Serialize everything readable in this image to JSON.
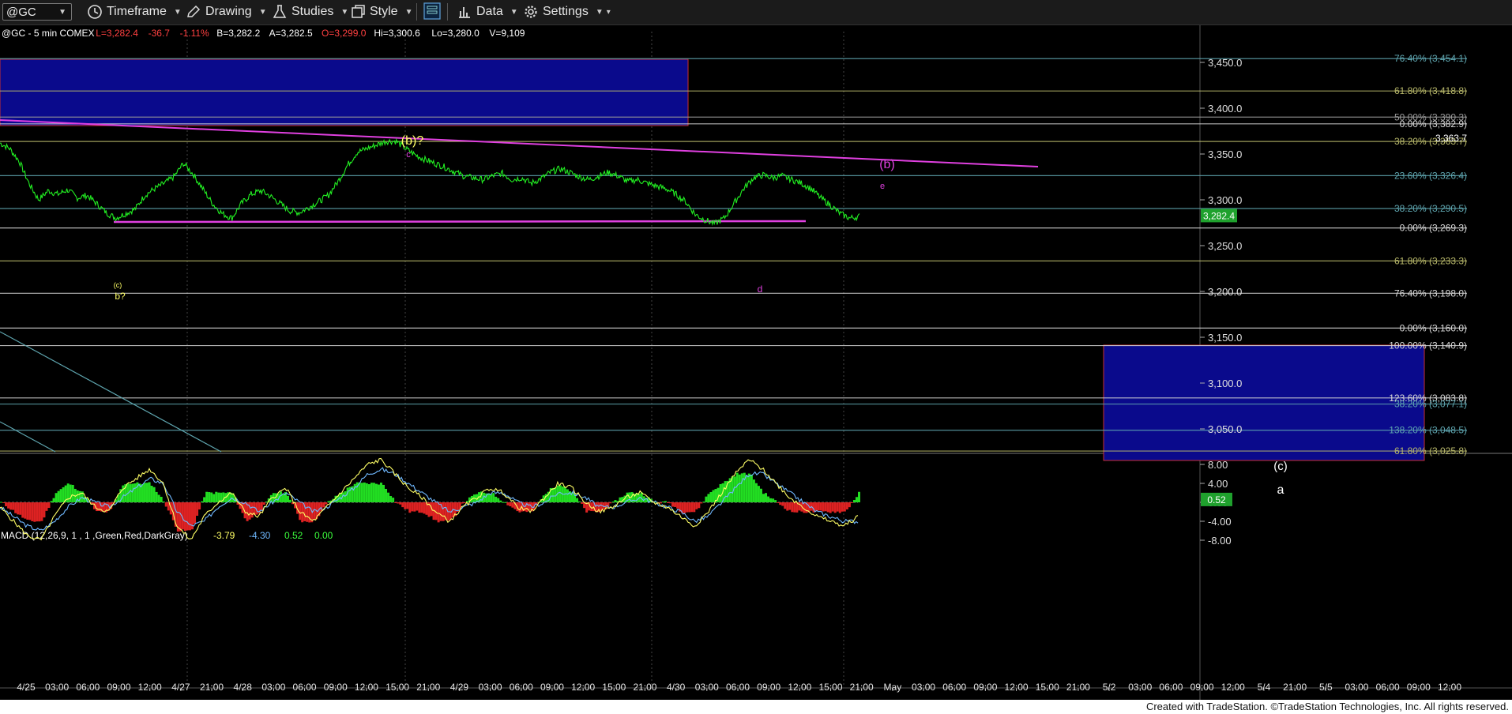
{
  "toolbar": {
    "symbol": "@GC",
    "timeframe_label": "Timeframe",
    "drawing_label": "Drawing",
    "studies_label": "Studies",
    "style_label": "Style",
    "data_label": "Data",
    "settings_label": "Settings",
    "icons": [
      "clock-icon",
      "pencil-icon",
      "flask-icon",
      "style-icon",
      "layout-icon",
      "bar-chart-icon",
      "gear-icon"
    ]
  },
  "header": {
    "symbol_info": "@GC - 5 min COMEX",
    "last": "L=3,282.4",
    "change": "-36.7",
    "change_pct": "-1.11%",
    "bid": "B=3,282.2",
    "ask": "A=3,282.5",
    "open": "O=3,299.0",
    "high": "Hi=3,300.6",
    "low": "Lo=3,280.0",
    "volume": "V=9,109"
  },
  "colors": {
    "price_line": "#22ee22",
    "magenta": "#e040e0",
    "yellow": "#ffff66",
    "fib_teal": "#5fa6b0",
    "fib_olive": "#b8b86a",
    "box_blue": "#0a0a8c",
    "box_border": "#c83030",
    "last_price_bg": "#1fa12d"
  },
  "footer": {
    "credit": "Created with TradeStation. ©TradeStation Technologies, Inc. All rights reserved."
  },
  "chart_data": [
    {
      "type": "line",
      "title": "@GC - 5 min COMEX",
      "ylim": [
        3010,
        3490
      ],
      "y_ticks": [
        "3,450.0",
        "3,400.0",
        "3,350.0",
        "3,300.0",
        "3,250.0",
        "3,200.0",
        "3,150.0",
        "3,100.0",
        "3,050.0"
      ],
      "y_tick_values": [
        3450,
        3400,
        3350,
        3300,
        3250,
        3200,
        3150,
        3100,
        3050
      ],
      "last_price_label": "3,282.4",
      "last_price": 3282.4,
      "x_ticks": [
        "4/25",
        "03:00",
        "06:00",
        "09:00",
        "12:00",
        "4/27",
        "21:00",
        "4/28",
        "03:00",
        "06:00",
        "09:00",
        "12:00",
        "15:00",
        "21:00",
        "4/29",
        "03:00",
        "06:00",
        "09:00",
        "12:00",
        "15:00",
        "21:00",
        "4/30",
        "03:00",
        "06:00",
        "09:00",
        "12:00",
        "15:00",
        "21:00",
        "May",
        "03:00",
        "06:00",
        "09:00",
        "12:00",
        "15:00",
        "21:00",
        "5/2",
        "03:00",
        "06:00",
        "09:00",
        "12:00",
        "5/4",
        "21:00",
        "5/5",
        "03:00",
        "06:00",
        "09:00",
        "12:00"
      ],
      "series": [
        {
          "values_x_index": [
            0,
            6,
            12,
            18,
            24,
            30,
            36,
            42,
            48,
            54,
            60,
            66,
            72,
            78,
            84,
            90,
            96,
            102,
            108,
            114,
            120,
            126,
            132,
            138,
            144,
            150,
            156,
            162,
            168,
            174,
            180,
            186,
            192,
            198,
            204,
            210,
            216,
            222,
            228,
            234,
            240,
            246,
            252,
            258,
            264,
            270,
            276,
            282,
            288,
            294,
            300,
            306,
            312,
            318,
            324,
            330,
            336,
            342,
            348,
            354,
            360,
            366,
            372,
            378,
            384,
            390,
            396,
            402,
            408,
            414,
            420,
            426,
            432,
            438,
            444,
            450
          ],
          "values": [
            3362,
            3356,
            3342,
            3318,
            3300,
            3310,
            3306,
            3311,
            3302,
            3305,
            3296,
            3286,
            3280,
            3285,
            3290,
            3305,
            3312,
            3318,
            3325,
            3340,
            3328,
            3312,
            3296,
            3285,
            3280,
            3296,
            3306,
            3310,
            3304,
            3296,
            3288,
            3286,
            3292,
            3298,
            3305,
            3320,
            3338,
            3352,
            3356,
            3360,
            3364,
            3364,
            3356,
            3349,
            3344,
            3340,
            3336,
            3331,
            3326,
            3324,
            3322,
            3326,
            3329,
            3322,
            3324,
            3318,
            3323,
            3330,
            3334,
            3330,
            3325,
            3322,
            3326,
            3330,
            3326,
            3320,
            3322,
            3318,
            3315,
            3312,
            3306,
            3298,
            3284,
            3278,
            3274,
            3280
          ],
          "note_tail": [
            3296,
            3312,
            3324,
            3327,
            3324,
            3326,
            3322,
            3318,
            3312,
            3302,
            3294,
            3285,
            3280,
            3282
          ]
        }
      ],
      "fib_levels": [
        {
          "label": "76.40% (3,454.1)",
          "value": 3454.1,
          "color": "teal"
        },
        {
          "label": "61.80% (3,418.8)",
          "value": 3418.8,
          "color": "olive"
        },
        {
          "label": "50.00% (3,390.3)",
          "value": 3390.3,
          "color": "gray"
        },
        {
          "label": "0.00% (3,382.9)",
          "value": 3382.9,
          "color": "white"
        },
        {
          "label": "38.20% (3,363.7)",
          "value": 3363.7,
          "color": "olive"
        },
        {
          "label": "23.60% (3,326.4)",
          "value": 3326.4,
          "color": "teal"
        },
        {
          "label": "38.20% (3,290.5)",
          "value": 3290.5,
          "color": "teal"
        },
        {
          "label": "0.00% (3,269.3)",
          "value": 3269.3,
          "color": "white"
        },
        {
          "label": "61.80% (3,233.3)",
          "value": 3233.3,
          "color": "olive"
        },
        {
          "label": "76.40% (3,198.0)",
          "value": 3198.0,
          "color": "white"
        },
        {
          "label": "0.00% (3,160.0)",
          "value": 3160.0,
          "color": "white"
        },
        {
          "label": "100.00% (3,140.9)",
          "value": 3140.9,
          "color": "white"
        },
        {
          "label": "123.60% (3,083.8)",
          "value": 3083.8,
          "color": "white"
        },
        {
          "label": "38.20% (3,077.1)",
          "value": 3077.1,
          "color": "teal"
        },
        {
          "label": "138.20% (3,048.5)",
          "value": 3048.5,
          "color": "teal"
        },
        {
          "label": "61.80% (3,025.8)",
          "value": 3025.8,
          "color": "olive"
        }
      ],
      "price_marker": {
        "label": "3,363.7",
        "value": 3363.7
      },
      "annotations": [
        {
          "text": "(b)?",
          "color": "yellow"
        },
        {
          "text": "c",
          "color": "magenta"
        },
        {
          "text": "(b)",
          "color": "magenta"
        },
        {
          "text": "e",
          "color": "magenta"
        },
        {
          "text": "d",
          "color": "magenta"
        },
        {
          "text": "(c)",
          "color": "yellow"
        },
        {
          "text": "b?",
          "color": "yellow"
        },
        {
          "text": "(c)",
          "color": "white"
        },
        {
          "text": "a",
          "color": "white"
        }
      ],
      "zones": [
        {
          "name": "upper-target-zone",
          "y_range": [
            3382,
            3455
          ]
        },
        {
          "name": "lower-target-zone",
          "y_range": [
            3035,
            3140
          ]
        }
      ],
      "grid": false
    },
    {
      "type": "line",
      "title": "MACD (12,26,9, 1 , 1 ,Green,Red,DarkGray)",
      "readouts": [
        "-3.79",
        "-4.30",
        "0.52",
        "0.00"
      ],
      "ylim": [
        -10,
        10
      ],
      "y_ticks": [
        "8.00",
        "4.00",
        "0.00",
        "-4.00",
        "-8.00"
      ],
      "y_tick_values": [
        8,
        4,
        0,
        -4,
        -8
      ],
      "last_value_label": "0.52",
      "last_value": 0.52,
      "series": [
        {
          "name": "MACD",
          "values": [
            -1,
            -4,
            -7,
            -8,
            -3,
            1,
            2,
            -1,
            -2,
            3,
            5,
            7,
            4,
            -5,
            -8,
            -3,
            0,
            2,
            -2,
            -3,
            1,
            3,
            -2,
            -4,
            -1,
            2,
            5,
            8,
            9,
            6,
            3,
            1,
            -2,
            -4,
            -1,
            1,
            3,
            2,
            -1,
            -2,
            1,
            4,
            3,
            0,
            -2,
            -1,
            1,
            2,
            0,
            -1,
            -3,
            -5,
            -2,
            2,
            6,
            9,
            7,
            4,
            1,
            -1,
            -3,
            -4,
            -5,
            -3
          ]
        },
        {
          "name": "Signal",
          "values": [
            -1,
            -3,
            -5,
            -6,
            -4,
            -1,
            1,
            0,
            -1,
            1,
            3,
            5,
            4,
            -2,
            -5,
            -4,
            -1,
            1,
            0,
            -2,
            0,
            2,
            0,
            -2,
            -1,
            1,
            3,
            6,
            7,
            6,
            4,
            2,
            0,
            -2,
            -1,
            0,
            2,
            2,
            0,
            -1,
            0,
            2,
            2,
            1,
            -1,
            -1,
            0,
            1,
            0,
            -1,
            -2,
            -4,
            -3,
            0,
            3,
            6,
            6,
            4,
            2,
            0,
            -2,
            -3,
            -4,
            -4
          ]
        }
      ]
    }
  ]
}
